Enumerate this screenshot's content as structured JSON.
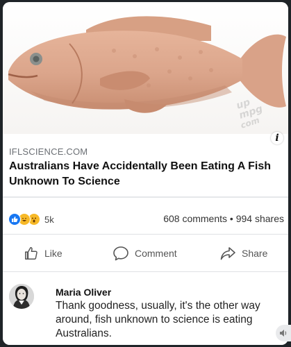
{
  "post": {
    "domain": "IFLSCIENCE.COM",
    "headline": "Australians Have Accidentally Been Eating A Fish Unknown To Science",
    "info_icon": "i",
    "watermark": "up mpg com"
  },
  "engagement": {
    "reaction_icons": [
      "like-icon",
      "haha-icon",
      "wow-icon"
    ],
    "reaction_count": "5k",
    "comments": "608 comments",
    "separator": "•",
    "shares": "994 shares"
  },
  "actions": {
    "like": "Like",
    "comment": "Comment",
    "share": "Share"
  },
  "comment": {
    "author": "Maria Oliver",
    "text": "Thank goodness, usually, it's the other way around, fish unknown to science is eating Australians."
  },
  "colors": {
    "like_blue": "#1877f2",
    "reaction_yellow": "#f7b928",
    "text": "#111111"
  }
}
